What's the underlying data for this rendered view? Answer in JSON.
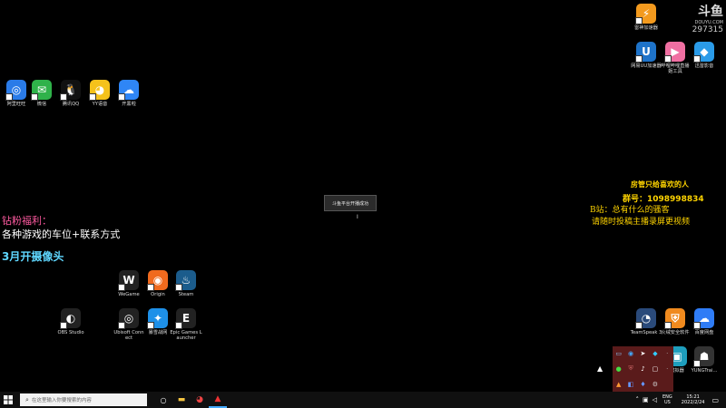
{
  "desktop_icons_left": [
    {
      "label": "阿里旺旺",
      "icon": "aliwangwang-icon",
      "color": "#2a7be8",
      "glyph": "◎"
    },
    {
      "label": "微信",
      "icon": "wechat-icon",
      "color": "#2fb24a",
      "glyph": "✉"
    },
    {
      "label": "腾讯QQ",
      "icon": "qq-icon",
      "color": "#111111",
      "glyph": "🐧"
    },
    {
      "label": "YY语音",
      "icon": "yy-icon",
      "color": "#f5c21b",
      "glyph": "◕"
    },
    {
      "label": "开黑啦",
      "icon": "kaiheila-icon",
      "color": "#2f86f6",
      "glyph": "☁"
    }
  ],
  "desktop_icons_right": [
    {
      "label": "雷神加速器",
      "icon": "leishen-icon",
      "color": "#f39a1e",
      "glyph": "⚡"
    },
    {
      "label": "网易UU加速器",
      "icon": "uu-icon",
      "color": "#1e73c9",
      "glyph": "U"
    },
    {
      "label": "哔哩哔哩直播姬工具",
      "icon": "bilibili-live-icon",
      "color": "#f06fa2",
      "glyph": "▶"
    },
    {
      "label": "迅雷影音",
      "icon": "xunlei-icon",
      "color": "#2a9be8",
      "glyph": "◆"
    }
  ],
  "game_launchers": [
    {
      "label": "WeGame",
      "icon": "wegame-icon",
      "color": "#222222",
      "glyph": "W"
    },
    {
      "label": "Origin",
      "icon": "origin-icon",
      "color": "#f06a1e",
      "glyph": "◉"
    },
    {
      "label": "Steam",
      "icon": "steam-icon",
      "color": "#1b5c8c",
      "glyph": "♨"
    },
    {
      "label": "Ubisoft Connect",
      "icon": "ubisoft-icon",
      "color": "#222222",
      "glyph": "◎"
    },
    {
      "label": "暴雪战网",
      "icon": "battlenet-icon",
      "color": "#1e90e8",
      "glyph": "✦"
    },
    {
      "label": "Epic Games Launcher",
      "icon": "epic-icon",
      "color": "#222222",
      "glyph": "E"
    },
    {
      "label": "OBS Studio",
      "icon": "obs-icon",
      "color": "#222222",
      "glyph": "◐"
    }
  ],
  "desktop_icons_bottom_right": [
    {
      "label": "TeamSpeak 3",
      "icon": "teamspeak-icon",
      "color": "#2a4a7a",
      "glyph": "◔"
    },
    {
      "label": "火绒安全软件",
      "icon": "huorong-icon",
      "color": "#f08a1e",
      "glyph": "⛨"
    },
    {
      "label": "百度网盘",
      "icon": "baidu-pan-icon",
      "color": "#2f7cf6",
      "glyph": "☁"
    },
    {
      "label": "模拟器",
      "icon": "emulator-icon",
      "color": "#1e9ebd",
      "glyph": "▣"
    },
    {
      "label": "YUNGTrai...",
      "icon": "yungtrai-icon",
      "color": "#333333",
      "glyph": "☗"
    }
  ],
  "overlay_left": {
    "line1": "钻粉福利：",
    "line2": "各种游戏的车位+联系方式",
    "line3": "3月开摄像头"
  },
  "overlay_right": {
    "line1": "房管只给喜欢的人",
    "line2": "群号：1098998834",
    "line3": "B站：总有什么的骚客",
    "line4": "请随时投稿主播录屏更视频"
  },
  "watermark": {
    "brand": "斗鱼",
    "site": "DOUYU.COM",
    "room": "297315"
  },
  "toast": {
    "text": "斗鱼平台开播成功"
  },
  "taskbar": {
    "search_placeholder": "在这里输入你要搜索的内容",
    "lang": "ENG",
    "region": "US",
    "time": "15:21",
    "date": "2022/2/24"
  },
  "colors": {
    "accent_yellow": "#ffd400",
    "overlay_cyan": "#5fd7ff",
    "overlay_pink": "#ff5aa0"
  }
}
